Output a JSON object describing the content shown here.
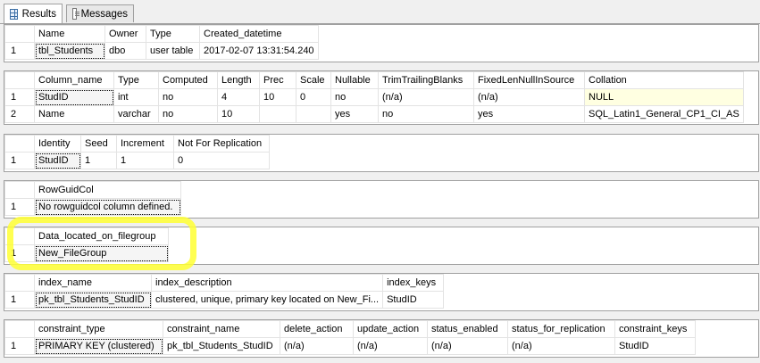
{
  "tabs": [
    {
      "label": "Results",
      "icon": "grid-icon"
    },
    {
      "label": "Messages",
      "icon": "messages-icon"
    }
  ],
  "grids": [
    {
      "columns": [
        "Name",
        "Owner",
        "Type",
        "Created_datetime"
      ],
      "rows": [
        [
          "1",
          "tbl_Students",
          "dbo",
          "user table",
          "2017-02-07 13:31:54.240"
        ]
      ]
    },
    {
      "columns": [
        "Column_name",
        "Type",
        "Computed",
        "Length",
        "Prec",
        "Scale",
        "Nullable",
        "TrimTrailingBlanks",
        "FixedLenNullInSource",
        "Collation"
      ],
      "rows": [
        [
          "1",
          "StudID",
          "int",
          "no",
          "4",
          "10",
          "0",
          "no",
          "(n/a)",
          "(n/a)",
          "NULL"
        ],
        [
          "2",
          "Name",
          "varchar",
          "no",
          "10",
          "",
          "",
          "yes",
          "no",
          "yes",
          "SQL_Latin1_General_CP1_CI_AS"
        ]
      ]
    },
    {
      "columns": [
        "Identity",
        "Seed",
        "Increment",
        "Not For Replication"
      ],
      "rows": [
        [
          "1",
          "StudID",
          "1",
          "1",
          "0"
        ]
      ]
    },
    {
      "columns": [
        "RowGuidCol"
      ],
      "rows": [
        [
          "1",
          "No rowguidcol column defined."
        ]
      ]
    },
    {
      "columns": [
        "Data_located_on_filegroup"
      ],
      "rows": [
        [
          "1",
          "New_FileGroup"
        ]
      ]
    },
    {
      "columns": [
        "index_name",
        "index_description",
        "index_keys"
      ],
      "rows": [
        [
          "1",
          "pk_tbl_Students_StudID",
          "clustered, unique, primary key located on New_Fi...",
          "StudID"
        ]
      ]
    },
    {
      "columns": [
        "constraint_type",
        "constraint_name",
        "delete_action",
        "update_action",
        "status_enabled",
        "status_for_replication",
        "constraint_keys"
      ],
      "rows": [
        [
          "1",
          "PRIMARY KEY (clustered)",
          "pk_tbl_Students_StudID",
          "(n/a)",
          "(n/a)",
          "(n/a)",
          "(n/a)",
          "StudID"
        ]
      ]
    }
  ],
  "colors": {
    "highlight": "#ffff33",
    "null_cell": "#ffffe1",
    "border": "#a0a0a0"
  }
}
